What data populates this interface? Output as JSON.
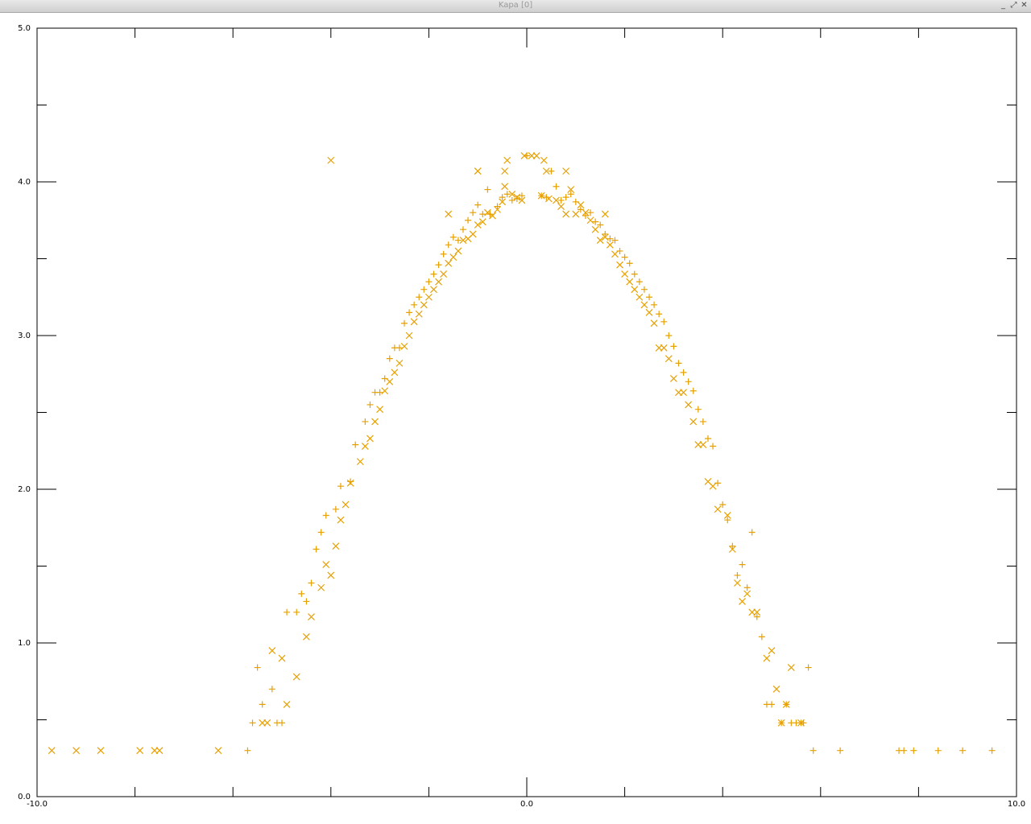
{
  "window": {
    "title": "Kapa [0]",
    "buttons": {
      "minimize": "_",
      "maximize": "⤢",
      "close": "✕"
    }
  },
  "colors": {
    "marker": "#e8a000",
    "frame": "#000000",
    "background": "#ffffff"
  },
  "chart_data": {
    "type": "scatter",
    "title": "",
    "xlabel": "",
    "ylabel": "",
    "xlim": [
      -10.0,
      10.0
    ],
    "ylim": [
      0.0,
      5.0
    ],
    "grid": false,
    "legend": "none",
    "x_ticks": [
      {
        "value": -10.0,
        "label": "-10.0"
      },
      {
        "value": 0.0,
        "label": "0.0"
      },
      {
        "value": 10.0,
        "label": "10.0"
      }
    ],
    "y_ticks": [
      {
        "value": 0.0,
        "label": "0.0"
      },
      {
        "value": 1.0,
        "label": "1.0"
      },
      {
        "value": 2.0,
        "label": "2.0"
      },
      {
        "value": 3.0,
        "label": "3.0"
      },
      {
        "value": 4.0,
        "label": "4.0"
      },
      {
        "value": 5.0,
        "label": "5.0"
      }
    ],
    "x_minor": [
      -8,
      -6,
      -4,
      -2,
      2,
      4,
      6,
      8
    ],
    "y_minor": [
      0.5,
      1.5,
      2.5,
      3.5,
      4.5
    ],
    "series": [
      {
        "marker": "plus",
        "points": [
          [
            -5.7,
            0.3
          ],
          [
            -5.6,
            0.48
          ],
          [
            -5.5,
            0.84
          ],
          [
            -5.4,
            0.6
          ],
          [
            -5.2,
            0.7
          ],
          [
            -5.1,
            0.48
          ],
          [
            -5.0,
            0.48
          ],
          [
            -4.9,
            1.2
          ],
          [
            -4.7,
            1.2
          ],
          [
            -4.6,
            1.32
          ],
          [
            -4.5,
            1.27
          ],
          [
            -4.4,
            1.39
          ],
          [
            -4.3,
            1.61
          ],
          [
            -4.2,
            1.72
          ],
          [
            -4.1,
            1.83
          ],
          [
            -3.9,
            1.87
          ],
          [
            -3.8,
            2.02
          ],
          [
            -3.6,
            2.05
          ],
          [
            -3.5,
            2.29
          ],
          [
            -3.3,
            2.44
          ],
          [
            -3.2,
            2.55
          ],
          [
            -3.1,
            2.63
          ],
          [
            -3.0,
            2.63
          ],
          [
            -2.9,
            2.72
          ],
          [
            -2.8,
            2.85
          ],
          [
            -2.7,
            2.92
          ],
          [
            -2.6,
            2.92
          ],
          [
            -2.5,
            3.08
          ],
          [
            -2.4,
            3.15
          ],
          [
            -2.3,
            3.2
          ],
          [
            -2.2,
            3.25
          ],
          [
            -2.1,
            3.3
          ],
          [
            -2.0,
            3.35
          ],
          [
            -1.9,
            3.4
          ],
          [
            -1.8,
            3.46
          ],
          [
            -1.7,
            3.53
          ],
          [
            -1.6,
            3.59
          ],
          [
            -1.5,
            3.64
          ],
          [
            -1.4,
            3.62
          ],
          [
            -1.3,
            3.69
          ],
          [
            -1.2,
            3.75
          ],
          [
            -1.1,
            3.8
          ],
          [
            -1.0,
            3.85
          ],
          [
            -0.9,
            3.79
          ],
          [
            -0.8,
            3.95
          ],
          [
            -0.75,
            3.79
          ],
          [
            -0.6,
            3.84
          ],
          [
            -0.5,
            3.9
          ],
          [
            -0.4,
            3.92
          ],
          [
            -0.3,
            3.88
          ],
          [
            -0.2,
            3.89
          ],
          [
            -0.1,
            3.91
          ],
          [
            0.0,
            4.17
          ],
          [
            0.3,
            3.91
          ],
          [
            0.4,
            3.9
          ],
          [
            0.5,
            4.07
          ],
          [
            0.6,
            3.97
          ],
          [
            0.7,
            3.88
          ],
          [
            0.8,
            3.9
          ],
          [
            0.9,
            3.92
          ],
          [
            1.0,
            3.87
          ],
          [
            1.1,
            3.82
          ],
          [
            1.2,
            3.78
          ],
          [
            1.3,
            3.8
          ],
          [
            1.4,
            3.74
          ],
          [
            1.5,
            3.72
          ],
          [
            1.6,
            3.66
          ],
          [
            1.7,
            3.63
          ],
          [
            1.8,
            3.62
          ],
          [
            1.9,
            3.55
          ],
          [
            2.0,
            3.51
          ],
          [
            2.1,
            3.47
          ],
          [
            2.2,
            3.4
          ],
          [
            2.3,
            3.35
          ],
          [
            2.4,
            3.3
          ],
          [
            2.5,
            3.25
          ],
          [
            2.6,
            3.2
          ],
          [
            2.7,
            3.14
          ],
          [
            2.8,
            3.09
          ],
          [
            2.9,
            3.0
          ],
          [
            3.0,
            2.93
          ],
          [
            3.1,
            2.82
          ],
          [
            3.2,
            2.76
          ],
          [
            3.3,
            2.7
          ],
          [
            3.4,
            2.64
          ],
          [
            3.5,
            2.52
          ],
          [
            3.6,
            2.44
          ],
          [
            3.7,
            2.33
          ],
          [
            3.8,
            2.28
          ],
          [
            3.9,
            2.04
          ],
          [
            4.0,
            1.9
          ],
          [
            4.1,
            1.8
          ],
          [
            4.2,
            1.63
          ],
          [
            4.3,
            1.44
          ],
          [
            4.4,
            1.51
          ],
          [
            4.5,
            1.36
          ],
          [
            4.6,
            1.72
          ],
          [
            4.7,
            1.17
          ],
          [
            4.8,
            1.04
          ],
          [
            4.9,
            0.6
          ],
          [
            5.0,
            0.6
          ],
          [
            5.2,
            0.48
          ],
          [
            5.3,
            0.6
          ],
          [
            5.4,
            0.48
          ],
          [
            5.5,
            0.48
          ],
          [
            5.6,
            0.48
          ],
          [
            5.65,
            0.48
          ],
          [
            5.75,
            0.84
          ],
          [
            5.85,
            0.3
          ],
          [
            6.4,
            0.3
          ],
          [
            7.6,
            0.3
          ],
          [
            7.7,
            0.3
          ],
          [
            7.9,
            0.3
          ],
          [
            8.4,
            0.3
          ],
          [
            8.9,
            0.3
          ],
          [
            9.5,
            0.3
          ]
        ]
      },
      {
        "marker": "cross",
        "points": [
          [
            -9.7,
            0.3
          ],
          [
            -9.2,
            0.3
          ],
          [
            -8.7,
            0.3
          ],
          [
            -7.9,
            0.3
          ],
          [
            -7.6,
            0.3
          ],
          [
            -7.5,
            0.3
          ],
          [
            -6.3,
            0.3
          ],
          [
            -5.4,
            0.48
          ],
          [
            -5.3,
            0.48
          ],
          [
            -5.2,
            0.95
          ],
          [
            -5.0,
            0.9
          ],
          [
            -4.9,
            0.6
          ],
          [
            -4.7,
            0.78
          ],
          [
            -4.5,
            1.04
          ],
          [
            -4.4,
            1.17
          ],
          [
            -4.2,
            1.36
          ],
          [
            -4.1,
            1.51
          ],
          [
            -4.0,
            1.44
          ],
          [
            -3.9,
            1.63
          ],
          [
            -3.8,
            1.8
          ],
          [
            -3.7,
            1.9
          ],
          [
            -3.6,
            2.04
          ],
          [
            -3.4,
            2.18
          ],
          [
            -3.3,
            2.28
          ],
          [
            -3.2,
            2.33
          ],
          [
            -3.1,
            2.44
          ],
          [
            -3.0,
            2.52
          ],
          [
            -2.9,
            2.64
          ],
          [
            -2.8,
            2.7
          ],
          [
            -2.7,
            2.76
          ],
          [
            -2.6,
            2.82
          ],
          [
            -2.5,
            2.93
          ],
          [
            -2.4,
            3.0
          ],
          [
            -2.3,
            3.09
          ],
          [
            -2.2,
            3.14
          ],
          [
            -2.1,
            3.2
          ],
          [
            -2.0,
            3.25
          ],
          [
            -1.9,
            3.3
          ],
          [
            -1.8,
            3.35
          ],
          [
            -1.7,
            3.4
          ],
          [
            -1.6,
            3.47
          ],
          [
            -1.5,
            3.51
          ],
          [
            -1.4,
            3.55
          ],
          [
            -1.3,
            3.62
          ],
          [
            -1.2,
            3.63
          ],
          [
            -1.1,
            3.66
          ],
          [
            -1.0,
            3.72
          ],
          [
            -0.9,
            3.74
          ],
          [
            -0.8,
            3.8
          ],
          [
            -0.7,
            3.78
          ],
          [
            -0.6,
            3.82
          ],
          [
            -0.5,
            3.87
          ],
          [
            -0.45,
            3.97
          ],
          [
            -0.3,
            3.92
          ],
          [
            -0.2,
            3.9
          ],
          [
            -0.1,
            3.88
          ],
          [
            0.1,
            4.17
          ],
          [
            0.2,
            4.17
          ],
          [
            0.3,
            3.91
          ],
          [
            0.45,
            3.89
          ],
          [
            0.6,
            3.88
          ],
          [
            0.7,
            3.84
          ],
          [
            0.8,
            3.79
          ],
          [
            0.9,
            3.95
          ],
          [
            1.0,
            3.79
          ],
          [
            1.1,
            3.85
          ],
          [
            1.2,
            3.8
          ],
          [
            1.3,
            3.75
          ],
          [
            1.4,
            3.69
          ],
          [
            1.5,
            3.62
          ],
          [
            1.6,
            3.64
          ],
          [
            1.7,
            3.59
          ],
          [
            1.8,
            3.53
          ],
          [
            1.9,
            3.46
          ],
          [
            2.0,
            3.4
          ],
          [
            2.1,
            3.35
          ],
          [
            2.2,
            3.3
          ],
          [
            2.3,
            3.25
          ],
          [
            2.4,
            3.2
          ],
          [
            2.5,
            3.15
          ],
          [
            2.6,
            3.08
          ],
          [
            2.7,
            2.92
          ],
          [
            2.8,
            2.92
          ],
          [
            2.9,
            2.85
          ],
          [
            3.0,
            2.72
          ],
          [
            3.1,
            2.63
          ],
          [
            3.2,
            2.63
          ],
          [
            3.3,
            2.55
          ],
          [
            3.4,
            2.44
          ],
          [
            3.5,
            2.29
          ],
          [
            3.6,
            2.29
          ],
          [
            3.7,
            2.05
          ],
          [
            3.8,
            2.02
          ],
          [
            3.9,
            1.87
          ],
          [
            4.1,
            1.83
          ],
          [
            4.2,
            1.61
          ],
          [
            4.3,
            1.39
          ],
          [
            4.4,
            1.27
          ],
          [
            4.5,
            1.32
          ],
          [
            4.6,
            1.2
          ],
          [
            4.7,
            1.2
          ],
          [
            4.9,
            0.9
          ],
          [
            5.0,
            0.95
          ],
          [
            5.1,
            0.7
          ],
          [
            5.2,
            0.48
          ],
          [
            5.3,
            0.6
          ],
          [
            5.4,
            0.84
          ],
          [
            5.6,
            0.48
          ],
          [
            -4.0,
            4.14
          ],
          [
            -1.0,
            4.07
          ],
          [
            -0.4,
            4.14
          ],
          [
            0.4,
            4.07
          ],
          [
            0.8,
            4.07
          ],
          [
            -0.45,
            4.07
          ],
          [
            0.35,
            4.14
          ],
          [
            -0.05,
            4.17
          ],
          [
            -1.6,
            3.79
          ],
          [
            1.6,
            3.79
          ],
          [
            -1.0,
            4.07
          ]
        ]
      }
    ]
  }
}
